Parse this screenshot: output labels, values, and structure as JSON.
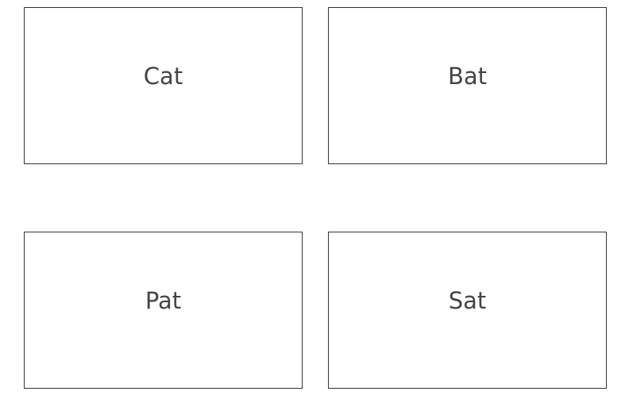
{
  "cards": [
    {
      "label": "Cat"
    },
    {
      "label": "Bat"
    },
    {
      "label": "Pat"
    },
    {
      "label": "Sat"
    }
  ]
}
